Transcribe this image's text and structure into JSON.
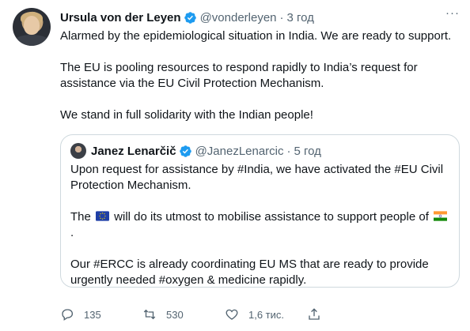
{
  "tweet": {
    "author_name": "Ursula von der Leyen",
    "handle": "@vonderleyen",
    "separator": "·",
    "time": "3 год",
    "paragraphs": [
      "Alarmed by the epidemiological situation in India. We are ready to support.",
      "The EU is pooling resources to respond rapidly to India’s request for assistance via the EU Civil Protection Mechanism.",
      "We stand in full solidarity with the Indian people!"
    ]
  },
  "quoted_tweet": {
    "author_name": "Janez Lenarčič",
    "handle": "@JanezLenarcic",
    "separator": "·",
    "time": "5 год",
    "paragraph1": "Upon request for assistance by #India, we have activated the #EU Civil Protection Mechanism.",
    "paragraph2_before": "The ",
    "paragraph2_middle": " will do its utmost to mobilise assistance to support people of ",
    "paragraph2_after": ".",
    "paragraph3": "Our #ERCC is already coordinating EU MS that are ready to provide urgently needed #oxygen & medicine rapidly.",
    "emoji": [
      "eu-flag",
      "india-flag"
    ]
  },
  "actions": {
    "reply_count": "135",
    "retweet_count": "530",
    "like_count": "1,6 тис."
  },
  "colors": {
    "verified": "#1d9bf0",
    "secondary_text": "#536471",
    "border": "#cfd9de"
  }
}
